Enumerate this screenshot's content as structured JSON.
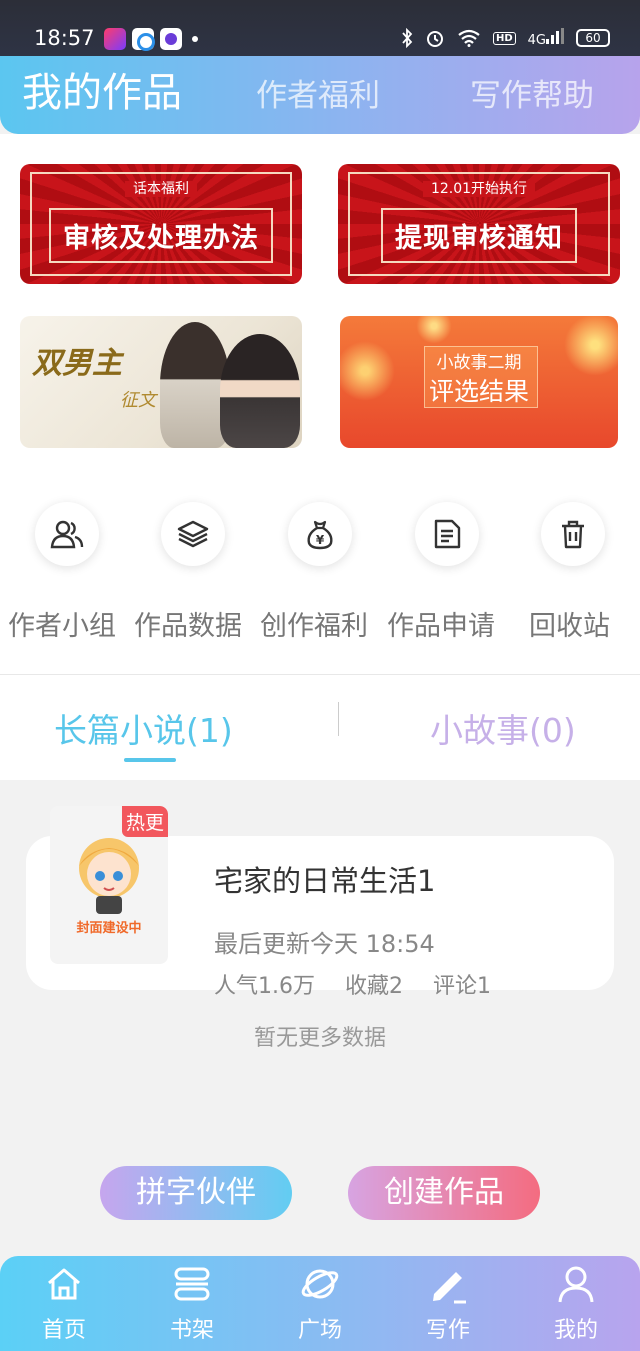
{
  "status_bar": {
    "time": "18:57",
    "signal": "4G",
    "hd": "HD",
    "battery": "60"
  },
  "header": {
    "tabs": [
      "我的作品",
      "作者福利",
      "写作帮助"
    ]
  },
  "banners": [
    {
      "kicker": "话本福利",
      "headline": "审核及处理办法"
    },
    {
      "kicker": "12.01开始执行",
      "headline": "提现审核通知"
    },
    {
      "script": "双男主",
      "script2": "征文"
    },
    {
      "sub": "小故事二期",
      "main": "评选结果"
    }
  ],
  "quick_actions": [
    {
      "label": "作者小组",
      "icon": "group-icon"
    },
    {
      "label": "作品数据",
      "icon": "layers-icon"
    },
    {
      "label": "创作福利",
      "icon": "money-bag-icon"
    },
    {
      "label": "作品申请",
      "icon": "document-icon"
    },
    {
      "label": "回收站",
      "icon": "trash-icon"
    }
  ],
  "work_tabs": {
    "novel": "长篇小说(1)",
    "story": "小故事(0)"
  },
  "work": {
    "tag": "热更",
    "cover_text": "封面建设中",
    "title": "宅家的日常生活1",
    "updated": "最后更新今天 18:54",
    "popularity": "人气1.6万",
    "favorites": "收藏2",
    "comments": "评论1"
  },
  "empty_text": "暂无更多数据",
  "buttons": {
    "partner": "拼字伙伴",
    "create": "创建作品"
  },
  "bottom_nav": [
    {
      "label": "首页",
      "icon": "home-icon"
    },
    {
      "label": "书架",
      "icon": "bookshelf-icon"
    },
    {
      "label": "广场",
      "icon": "planet-icon"
    },
    {
      "label": "写作",
      "icon": "pen-icon"
    },
    {
      "label": "我的",
      "icon": "user-icon"
    }
  ],
  "colors": {
    "accent_blue": "#58c6ea",
    "accent_purple": "#c6b0e8",
    "tag_red": "#f2575d"
  }
}
